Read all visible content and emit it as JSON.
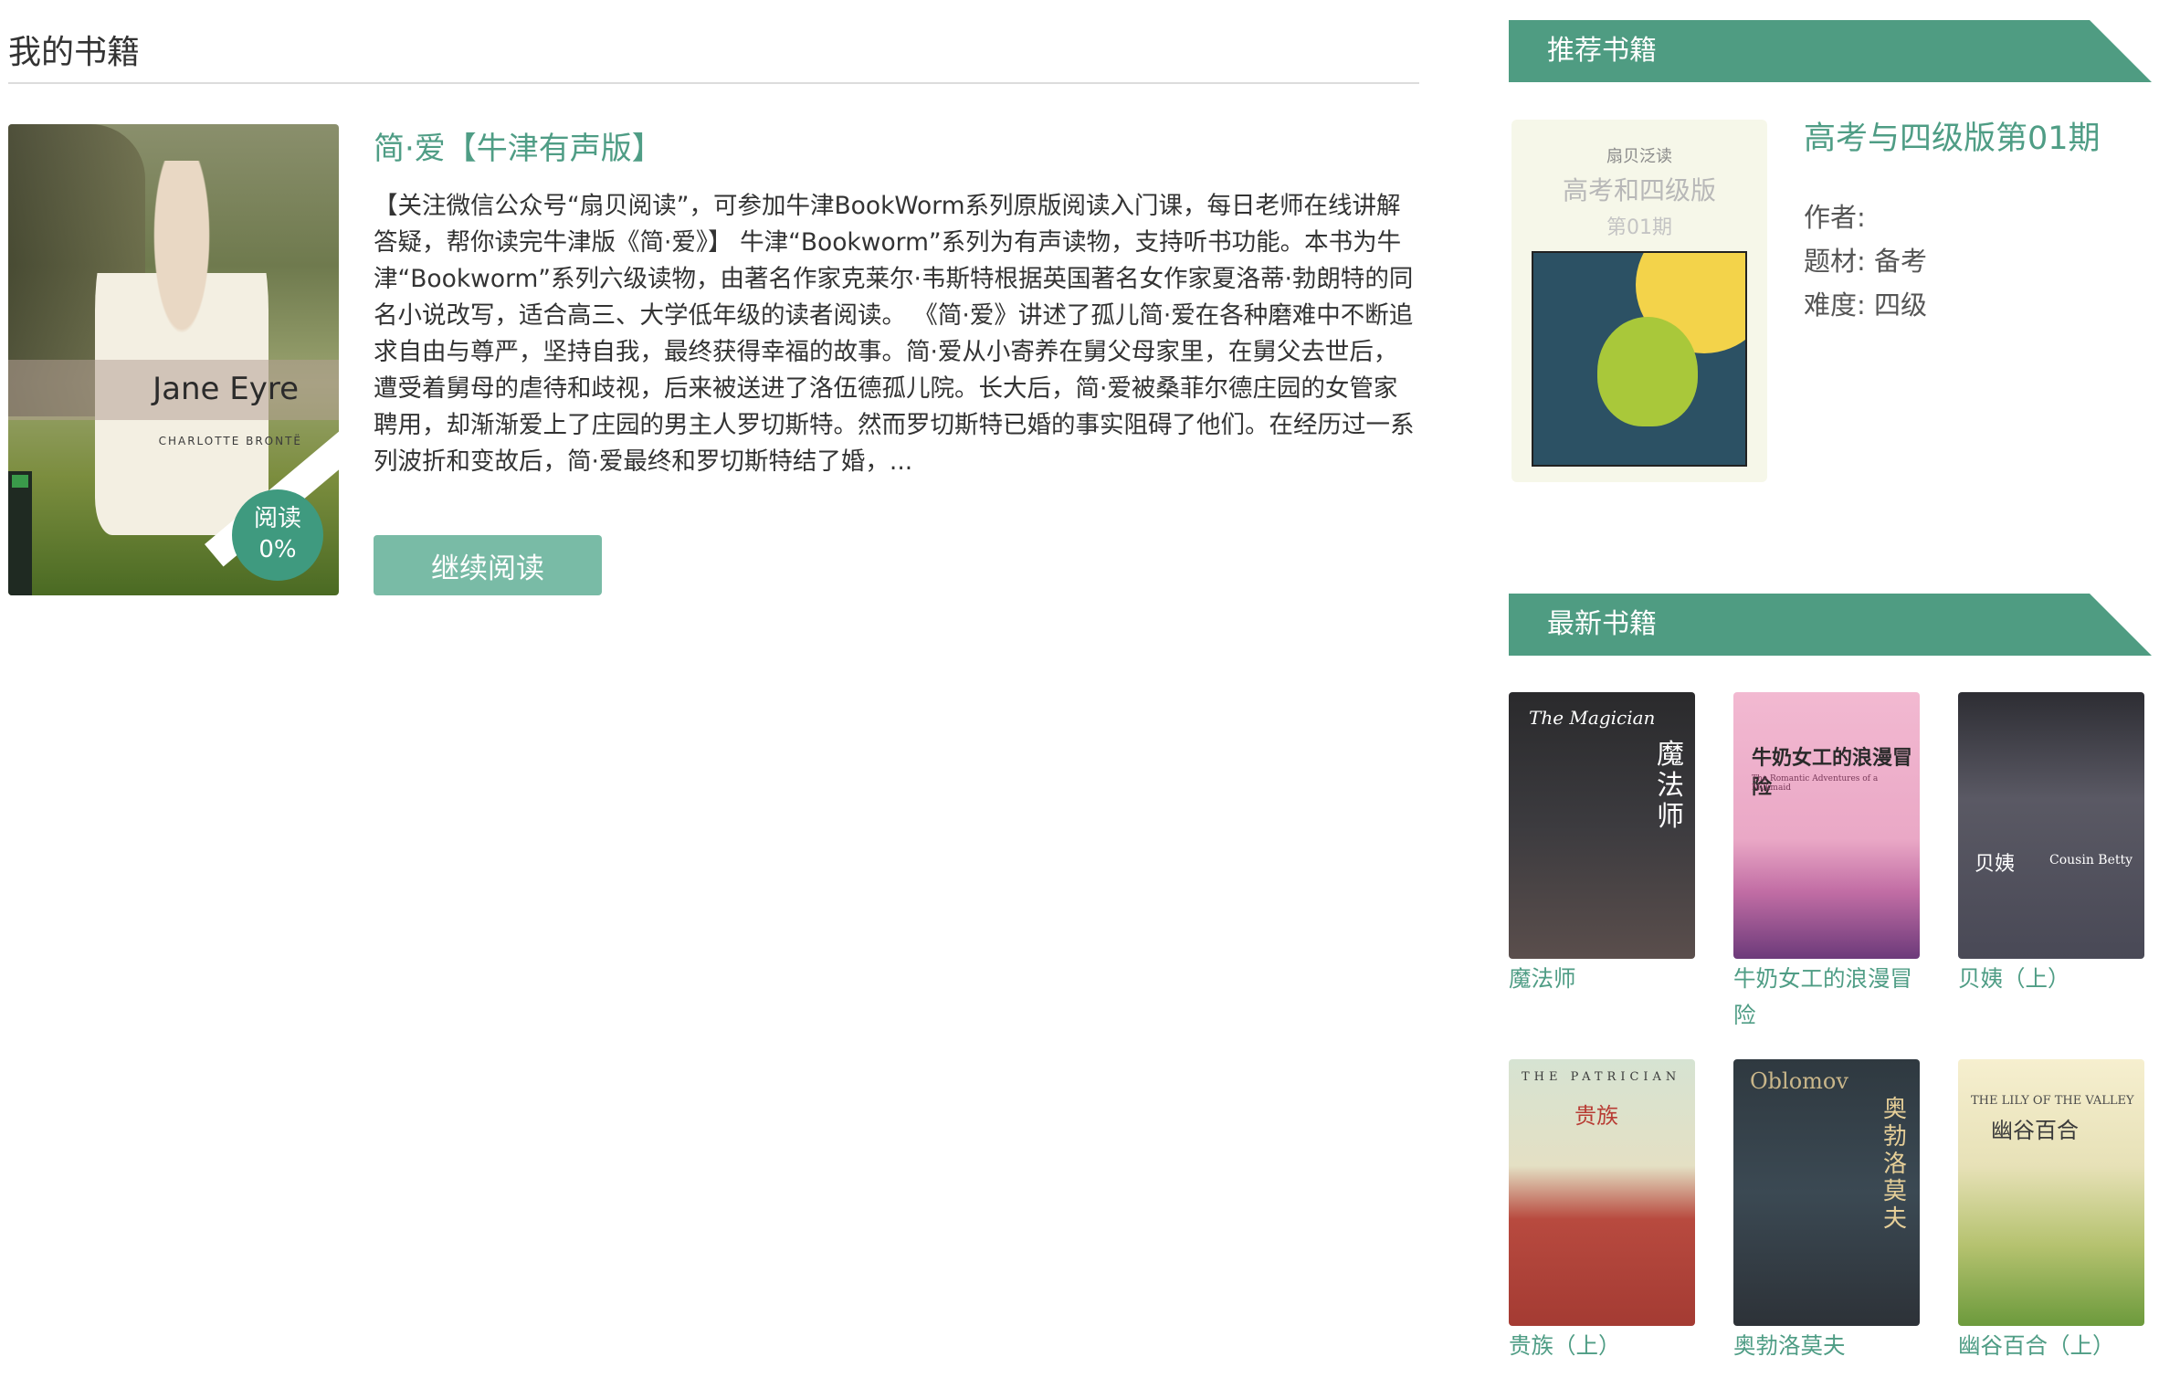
{
  "my_books": {
    "section_title": "我的书籍",
    "book": {
      "title": "简·爱【牛津有声版】",
      "description": "【关注微信公众号“扇贝阅读”，可参加牛津BookWorm系列原版阅读入门课，每日老师在线讲解答疑，帮你读完牛津版《简·爱》】 牛津“Bookworm”系列为有声读物，支持听书功能。本书为牛津“Bookworm”系列六级读物，由著名作家克莱尔·韦斯特根据英国著名女作家夏洛蒂·勃朗特的同名小说改写，适合高三、大学低年级的读者阅读。 《简·爱》讲述了孤儿简·爱在各种磨难中不断追求自由与尊严，坚持自我，最终获得幸福的故事。简·爱从小寄养在舅父母家里，在舅父去世后，遭受着舅母的虐待和歧视，后来被送进了洛伍德孤儿院。长大后，简·爱被桑菲尔德庄园的女管家聘用，却渐渐爱上了庄园的男主人罗切斯特。然而罗切斯特已婚的事实阻碍了他们。在经历过一系列波折和变故后，简·爱最终和罗切斯特结了婚，...",
      "cover_title": "Jane Eyre",
      "cover_author": "CHARLOTTE BRONTË",
      "progress_label": "阅读",
      "progress_value": "0%",
      "continue_button": "继续阅读"
    }
  },
  "recommended": {
    "header": "推荐书籍",
    "cover_line1": "扇贝泛读",
    "cover_line2": "高考和四级版",
    "cover_line3": "第01期",
    "title": "高考与四级版第01期",
    "author_label": "作者:",
    "author_value": "",
    "topic_label": "题材:",
    "topic_value": "备考",
    "difficulty_label": "难度:",
    "difficulty_value": "四级"
  },
  "newest": {
    "header": "最新书籍",
    "books": [
      {
        "caption": "魔法师",
        "cover_text": "The Magician",
        "cover_cn": "魔法师"
      },
      {
        "caption": "牛奶女工的浪漫冒险",
        "cover_text": "The Romantic Adventures of a Milkmaid",
        "cover_cn": "牛奶女工的浪漫冒险"
      },
      {
        "caption": "贝姨（上）",
        "cover_text": "Cousin Betty",
        "cover_cn": "贝姨"
      },
      {
        "caption": "贵族（上）",
        "cover_text": "THE PATRICIAN",
        "cover_cn": "贵族"
      },
      {
        "caption": "奥勃洛莫夫",
        "cover_text": "Oblomov",
        "cover_cn": "奥勃洛莫夫"
      },
      {
        "caption": "幽谷百合（上）",
        "cover_text": "THE LILY OF THE VALLEY",
        "cover_cn": "幽谷百合"
      }
    ]
  },
  "colors": {
    "accent": "#4f9c82",
    "link": "#4f9d85",
    "button": "#79bba6"
  }
}
